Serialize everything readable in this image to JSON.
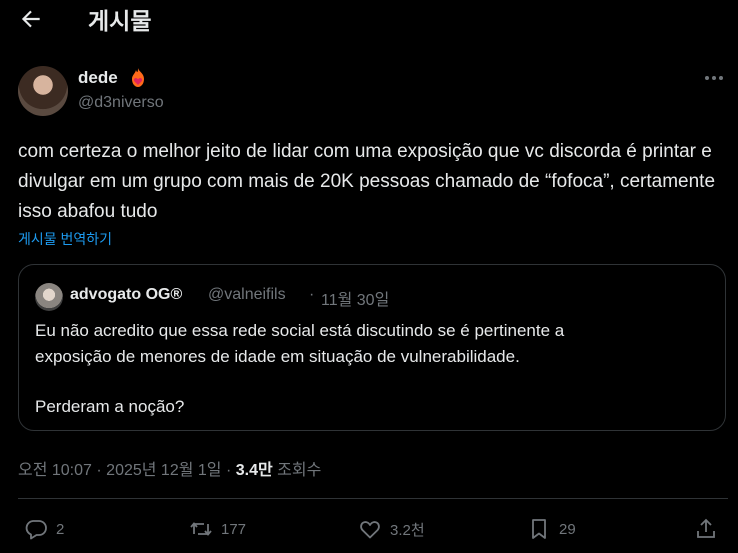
{
  "header": {
    "title": "게시물"
  },
  "author": {
    "name": "dede",
    "handle": "@d3niverso"
  },
  "tweet": {
    "text": "com certeza o melhor jeito de lidar com uma exposição que vc discorda é printar e divulgar em um grupo com mais de 20K pessoas chamado de “fofoca”, certamente isso abafou tudo",
    "translate_label": "게시물 번역하기"
  },
  "quote": {
    "name": "advogato OG®",
    "handle": "@valneifils",
    "separator": "·",
    "date": "11월 30일",
    "line1": "Eu não acredito que essa rede social está discutindo se é pertinente a",
    "line2": "exposição de menores de idade em situação de vulnerabilidade.",
    "line3": "Perderam a noção?"
  },
  "meta": {
    "time": "오전 10:07",
    "sep1": "·",
    "date": "2025년 12월 1일",
    "sep2": "·",
    "views": "3.4만",
    "views_label": "조회수"
  },
  "actions": {
    "reply": "2",
    "retweet": "177",
    "like": "3.2천",
    "bookmark": "29"
  },
  "colors": {
    "link": "#1d9bf0",
    "muted": "#71767b",
    "text": "#e7e9ea",
    "border": "#2f3336"
  }
}
